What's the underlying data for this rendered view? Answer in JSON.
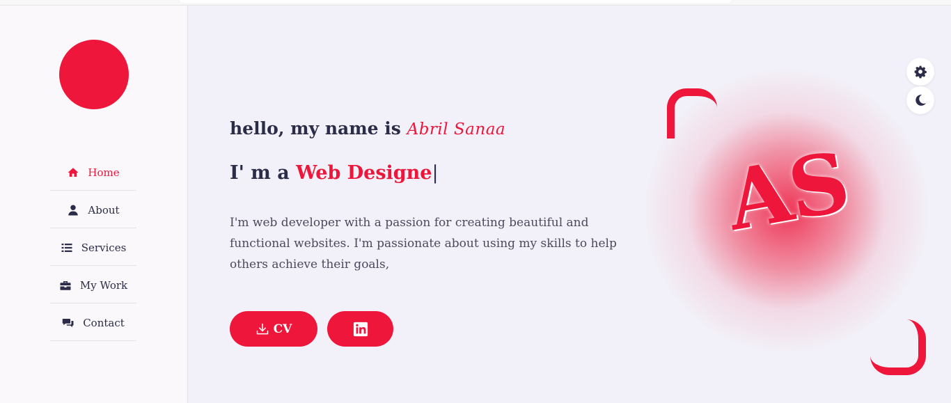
{
  "sidebar": {
    "avatar": "avatar",
    "items": [
      {
        "label": "Home",
        "icon": "home-icon",
        "active": true
      },
      {
        "label": "About",
        "icon": "user-icon",
        "active": false
      },
      {
        "label": "Services",
        "icon": "list-icon",
        "active": false
      },
      {
        "label": "My Work",
        "icon": "briefcase-icon",
        "active": false
      },
      {
        "label": "Contact",
        "icon": "comments-icon",
        "active": false
      }
    ]
  },
  "hero": {
    "greeting": "hello, my name is",
    "name": "Abril Sanaa",
    "role_prefix": "I' m a",
    "role_typed": "Web Designe",
    "cursor": "|",
    "description": "I'm web developer with a passion for creating beautiful and functional websites. I'm passionate about using my skills to help others achieve their goals,",
    "cv_button": "CV",
    "linkedin_icon": "linkedin-icon",
    "logo_text": "AS"
  },
  "controls": {
    "settings_icon": "gear-icon",
    "theme_icon": "moon-icon"
  },
  "colors": {
    "accent": "#ee163a",
    "text": "#2b2c48",
    "background": "#f2f1f9",
    "sidebar": "#fbf8fc"
  }
}
